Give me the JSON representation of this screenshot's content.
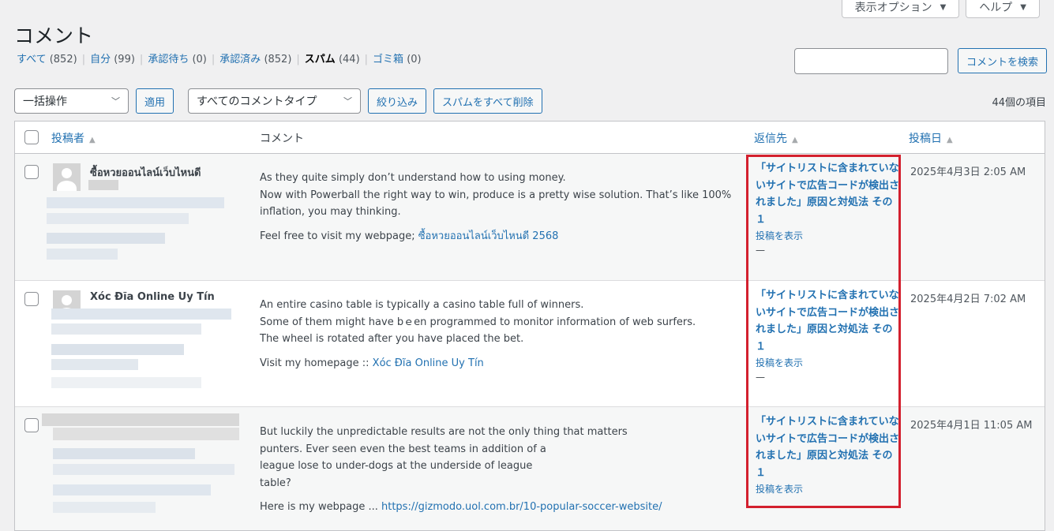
{
  "header": {
    "title": "コメント",
    "screen_options": "表示オプション",
    "help": "ヘルプ"
  },
  "filters": [
    {
      "label": "すべて",
      "count": "(852)"
    },
    {
      "label": "自分",
      "count": "(99)"
    },
    {
      "label": "承認待ち",
      "count": "(0)"
    },
    {
      "label": "承認済み",
      "count": "(852)"
    },
    {
      "label": "スパム",
      "count": "(44)",
      "current": true
    },
    {
      "label": "ゴミ箱",
      "count": "(0)"
    }
  ],
  "search": {
    "value": "",
    "button": "コメントを検索"
  },
  "toolbar": {
    "bulk_action": "一括操作",
    "apply": "適用",
    "comment_type": "すべてのコメントタイプ",
    "filter": "絞り込み",
    "empty_spam": "スパムをすべて削除",
    "items_count": "44個の項目"
  },
  "columns": {
    "author": "投稿者",
    "comment": "コメント",
    "response": "返信先",
    "date": "投稿日"
  },
  "rows": [
    {
      "author": "ซื้อหวยออนไลน์เว็บไหนดี",
      "lines": [
        "As they quite simply don’t understand how to using money.",
        "Now with Powerball the right way to win, produce is a pretty wise solution. That’s like 100%",
        "inflation, you may thinking."
      ],
      "link_prefix": "Feel free to visit my webpage; ",
      "link_text": "ซื้อหวยออนไลน์เว็บไหนดี 2568",
      "response_title": "「サイトリストに含まれていないサイトで広告コードが検出されました」原因と対処法 その１",
      "view_post": "投稿を表示",
      "dash": "—",
      "date": "2025年4月3日 2:05 AM"
    },
    {
      "author": "Xóc Đĩa Online Uy Tín",
      "lines": [
        "An entire casino table is typically a casino table full of winners.",
        "Some of them might have bｅen programmed to monitor information of web surfers.",
        "The wheel is rotated after you have placed the bet."
      ],
      "link_prefix": "Visit my homepage :: ",
      "link_text": "Xóc Đĩa Online Uy Tín",
      "response_title": "「サイトリストに含まれていないサイトで広告コードが検出されました」原因と対処法 その１",
      "view_post": "投稿を表示",
      "dash": "—",
      "date": "2025年4月2日 7:02 AM"
    },
    {
      "author": "",
      "lines": [
        "But luckily the unpredictable results are not the only thing that matters",
        "punters. Ever seen even the best teams in addition of a",
        "league lose to under-dogs at the underside of league",
        "table?"
      ],
      "link_prefix": "Here is my webpage ... ",
      "link_text": "https://gizmodo.uol.com.br/10-popular-soccer-website/",
      "response_title": "「サイトリストに含まれていないサイトで広告コードが検出されました」原因と対処法 その１",
      "view_post": "投稿を表示",
      "dash": "",
      "date": "2025年4月1日 11:05 AM"
    }
  ]
}
